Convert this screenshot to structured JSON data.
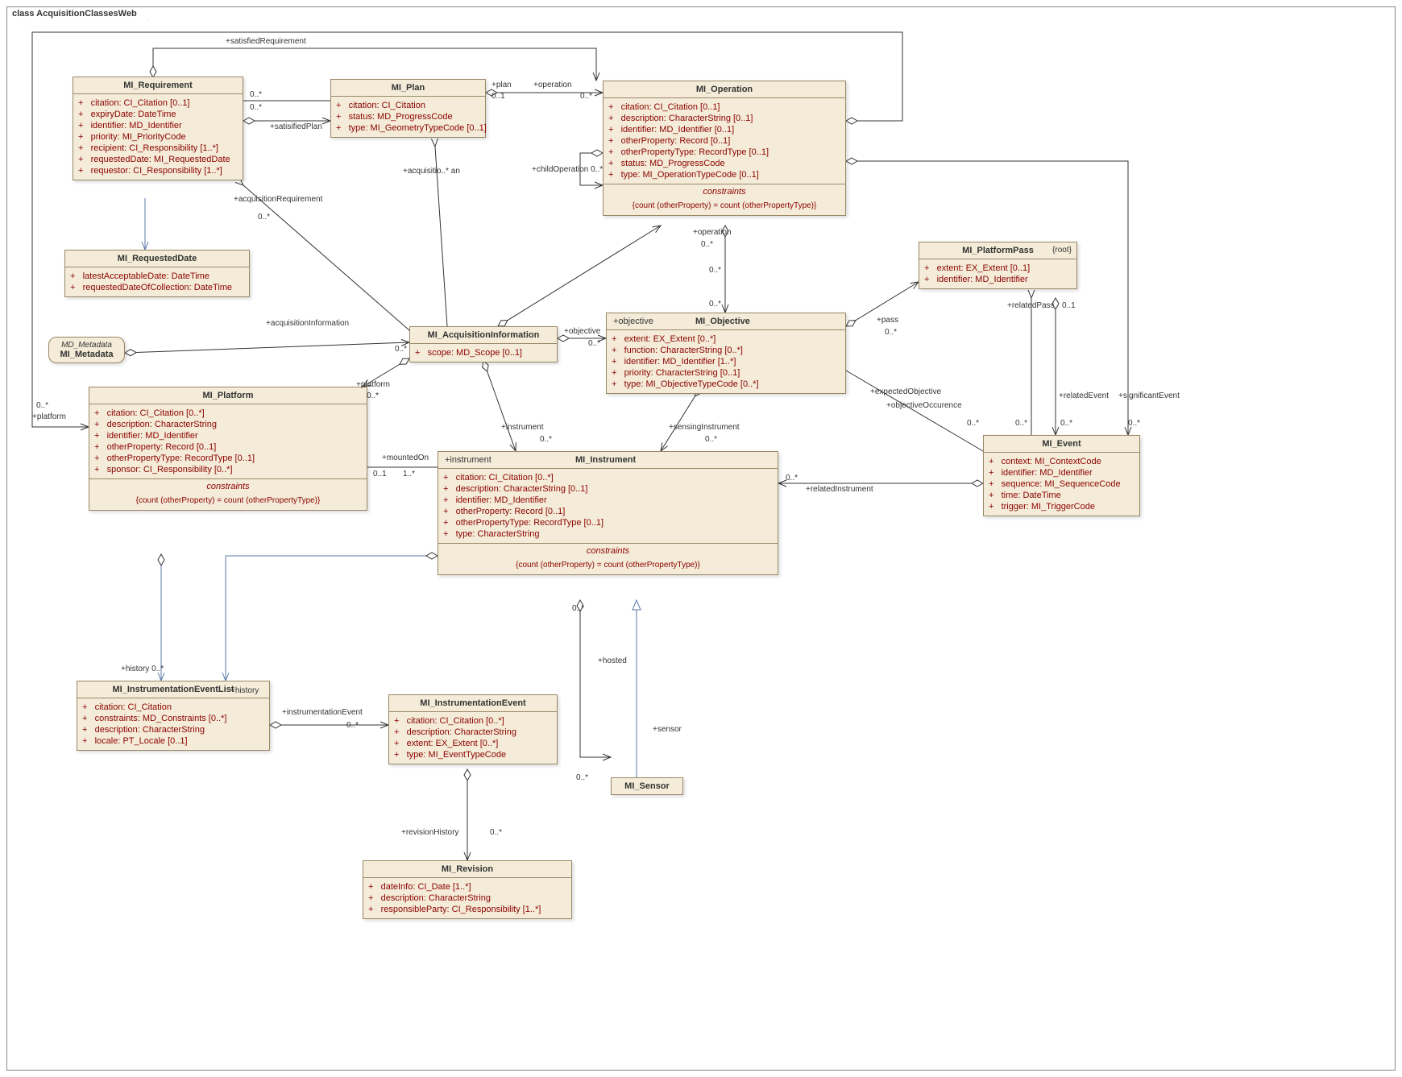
{
  "frame": {
    "title": "class AcquisitionClassesWeb"
  },
  "classes": {
    "requirement": {
      "name": "MI_Requirement",
      "attrs": [
        "+   citation: CI_Citation [0..1]",
        "+   expiryDate: DateTime",
        "+   identifier: MD_Identifier",
        "+   priority: MI_PriorityCode",
        "+   recipient: CI_Responsibility [1..*]",
        "+   requestedDate: MI_RequestedDate",
        "+   requestor: CI_Responsibility [1..*]"
      ]
    },
    "requestedDate": {
      "name": "MI_RequestedDate",
      "attrs": [
        "+   latestAcceptableDate: DateTime",
        "+   requestedDateOfCollection: DateTime"
      ]
    },
    "plan": {
      "name": "MI_Plan",
      "attrs": [
        "+   citation: CI_Citation",
        "+   status: MD_ProgressCode",
        "+   type: MI_GeometryTypeCode [0..1]"
      ]
    },
    "operation": {
      "name": "MI_Operation",
      "attrs": [
        "+   citation: CI_Citation [0..1]",
        "+   description: CharacterString [0..1]",
        "+   identifier: MD_Identifier [0..1]",
        "+   otherProperty: Record [0..1]",
        "+   otherPropertyType: RecordType [0..1]",
        "+   status: MD_ProgressCode",
        "+   type: MI_OperationTypeCode [0..1]"
      ],
      "constraintsTitle": "constraints",
      "constraints": "{count (otherProperty) = count (otherPropertyType)}"
    },
    "acqInfo": {
      "name": "MI_AcquisitionInformation",
      "attrs": [
        "+   scope: MD_Scope [0..1]"
      ]
    },
    "metadata": {
      "stereo": "MD_Metadata",
      "name": "MI_Metadata"
    },
    "objective": {
      "name": "MI_Objective",
      "attrs": [
        "+   extent: EX_Extent [0..*]",
        "+   function: CharacterString [0..*]",
        "+   identifier: MD_Identifier [1..*]",
        "+   priority: CharacterString [0..1]",
        "+   type: MI_ObjectiveTypeCode [0..*]"
      ]
    },
    "platformPass": {
      "name": "MI_PlatformPass",
      "root": "{root}",
      "attrs": [
        "+   extent: EX_Extent [0..1]",
        "+   identifier: MD_Identifier"
      ]
    },
    "event": {
      "name": "MI_Event",
      "attrs": [
        "+   context: MI_ContextCode",
        "+   identifier: MD_Identifier",
        "+   sequence: MI_SequenceCode",
        "+   time: DateTime",
        "+   trigger: MI_TriggerCode"
      ]
    },
    "platform": {
      "name": "MI_Platform",
      "attrs": [
        "+   citation: CI_Citation [0..*]",
        "+   description: CharacterString",
        "+   identifier: MD_Identifier",
        "+   otherProperty: Record [0..1]",
        "+   otherPropertyType: RecordType [0..1]",
        "+   sponsor: CI_Responsibility [0..*]"
      ],
      "constraintsTitle": "constraints",
      "constraints": "{count (otherProperty) = count (otherPropertyType)}"
    },
    "instrument": {
      "name": "MI_Instrument",
      "attrs": [
        "+   citation: CI_Citation [0..*]",
        "+   description: CharacterString [0..1]",
        "+   identifier: MD_Identifier",
        "+   otherProperty: Record [0..1]",
        "+   otherPropertyType: RecordType [0..1]",
        "+   type: CharacterString"
      ],
      "constraintsTitle": "constraints",
      "constraints": "{count (otherProperty) = count (otherPropertyType)}"
    },
    "instrEventList": {
      "name": "MI_InstrumentationEventList",
      "attrs": [
        "+   citation: CI_Citation",
        "+   constraints: MD_Constraints [0..*]",
        "+   description: CharacterString",
        "+   locale: PT_Locale [0..1]"
      ]
    },
    "instrEvent": {
      "name": "MI_InstrumentationEvent",
      "attrs": [
        "+   citation: CI_Citation [0..*]",
        "+   description: CharacterString",
        "+   extent: EX_Extent [0..*]",
        "+   type: MI_EventTypeCode"
      ]
    },
    "revision": {
      "name": "MI_Revision",
      "attrs": [
        "+   dateInfo: CI_Date [1..*]",
        "+   description: CharacterString",
        "+   responsibleParty: CI_Responsibility [1..*]"
      ]
    },
    "sensor": {
      "name": "MI_Sensor"
    }
  },
  "labels": {
    "satisfiedRequirement": "+satisfiedRequirement",
    "satisifiedPlan": "+satisifiedPlan",
    "acquisitionRequirement": "+acquisitionRequirement",
    "acquisitioan": "+acquisitio..*  an",
    "acquisitionInformation": "+acquisitionInformation",
    "plan_role": "+plan",
    "operation_role": "+operation",
    "childOperation": "+childOperation 0..*",
    "objective_role": "+objective",
    "pass_role": "+pass",
    "platform_role": "+platform",
    "instrument_role": "+instrument",
    "sensingInstrument": "+sensingInstrument",
    "mountedOn": "+mountedOn",
    "relatedInstrument": "+relatedInstrument",
    "relatedPass": "+relatedPass",
    "relatedEvent": "+relatedEvent",
    "significantEvent": "+significantEvent",
    "expectedObjective": "+expectedObjective",
    "objectiveOccurence": "+objectiveOccurence",
    "history": "+history",
    "history2": "+history  0..*",
    "instrumentationEvent": "+instrumentationEvent",
    "revisionHistory": "+revisionHistory",
    "hosted": "+hosted",
    "sensor_role": "+sensor",
    "m0s": "0..*",
    "m01": "0..1",
    "m1s": "1..*"
  }
}
